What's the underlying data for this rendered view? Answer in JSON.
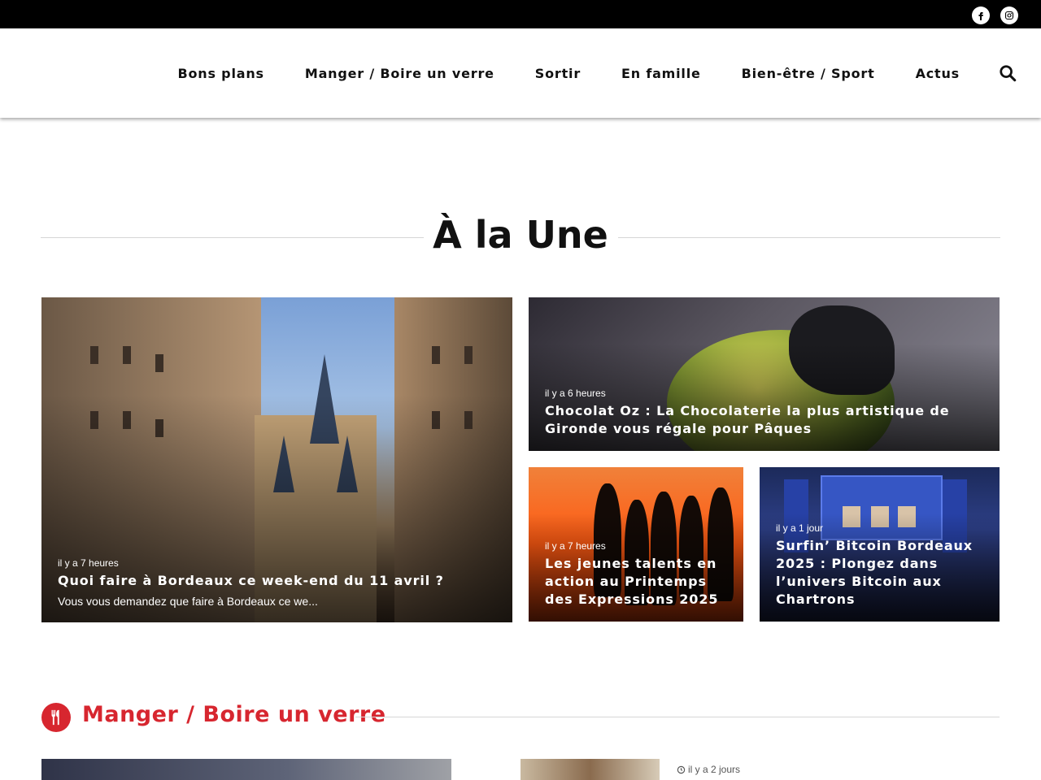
{
  "topbar": {
    "social": [
      {
        "icon": "facebook-icon"
      },
      {
        "icon": "instagram-icon"
      }
    ]
  },
  "nav": {
    "items": [
      "Bons plans",
      "Manger / Boire un verre",
      "Sortir",
      "En famille",
      "Bien-être / Sport",
      "Actus"
    ],
    "search_icon": "search-icon"
  },
  "une": {
    "title": "À la Une",
    "cards": [
      {
        "time": "il y a 7 heures",
        "headline": "Quoi faire à Bordeaux ce week-end du 11 avril ?",
        "excerpt": "Vous vous demandez que faire à Bordeaux ce we..."
      },
      {
        "time": "il y a 6 heures",
        "headline": "Chocolat Oz : La Chocolaterie la plus artistique de Gironde vous régale pour Pâques"
      },
      {
        "time": "il y a 7 heures",
        "headline": "Les jeunes talents en action au Printemps des Expressions 2025"
      },
      {
        "time": "il y a 1 jour",
        "headline": "Surfin’ Bitcoin Bordeaux 2025 : Plongez dans l’univers Bitcoin aux Chartrons"
      }
    ]
  },
  "manger": {
    "title": "Manger / Boire un verre",
    "icon": "fork-knife-icon",
    "items": [
      {
        "time": "il y a 2 jours"
      }
    ]
  },
  "colors": {
    "accent": "#d7262f",
    "topbar": "#000000"
  }
}
